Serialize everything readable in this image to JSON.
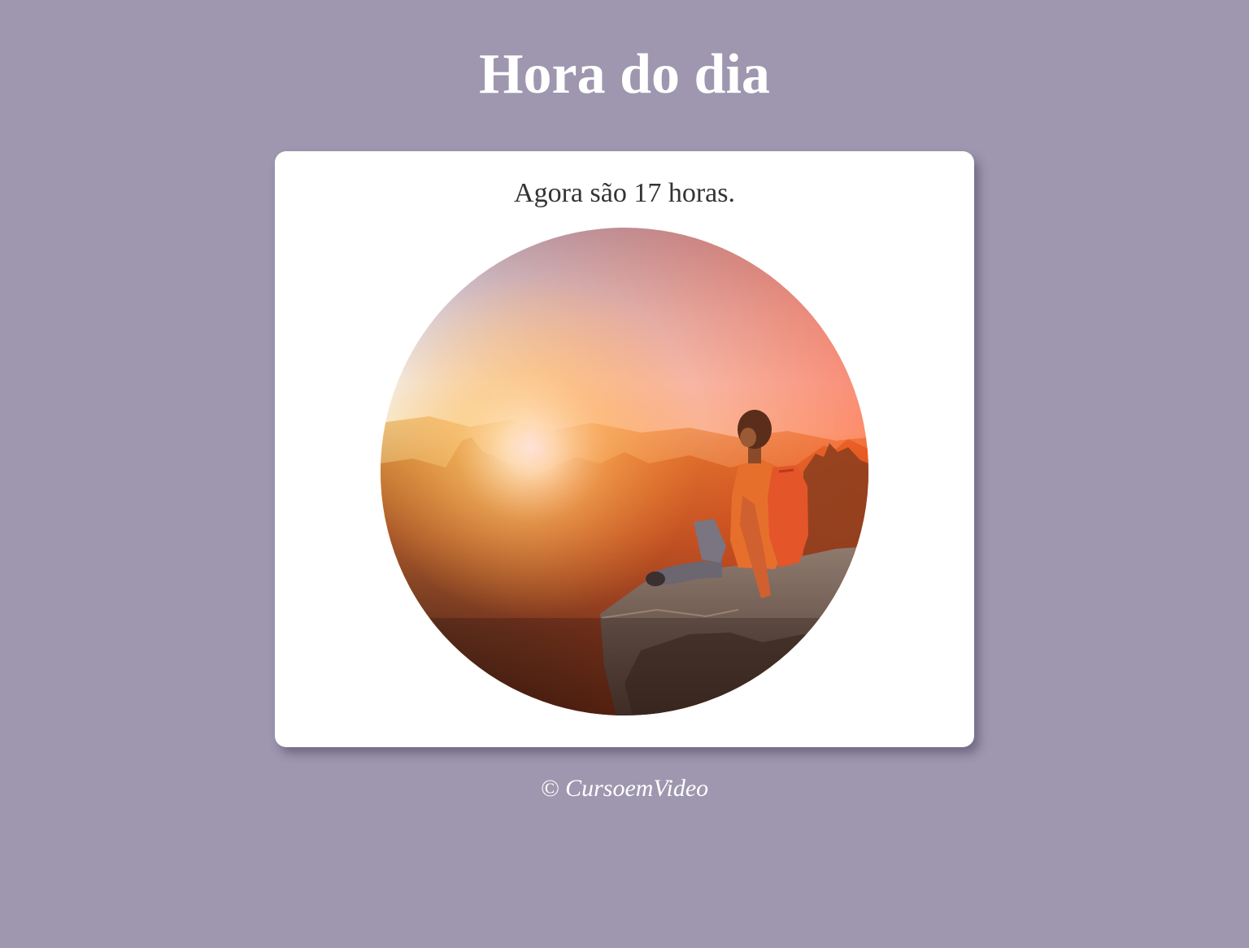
{
  "header": {
    "title": "Hora do dia"
  },
  "card": {
    "message": "Agora são 17 horas.",
    "image_icon": "sunset-photo-icon"
  },
  "footer": {
    "copyright": "© CursoemVideo"
  },
  "colors": {
    "background": "#9e97af",
    "card": "#ffffff",
    "text": "#333333",
    "heading": "#ffffff"
  }
}
